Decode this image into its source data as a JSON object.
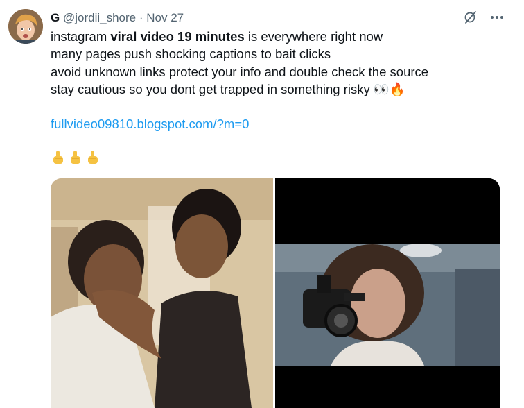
{
  "author": {
    "display_name": "G",
    "handle": "@jordii_shore",
    "separator": "·",
    "date": "Nov 27"
  },
  "tweet": {
    "line1_pre": "instagram ",
    "line1_bold": "viral video 19 minutes",
    "line1_post": " is everywhere right now",
    "line2": "many pages push shocking captions to bait clicks",
    "line3": "avoid unknown links protect your info and double check the source",
    "line4_text": "stay cautious so you dont get trapped in something risky ",
    "line4_emoji_eyes": "👀",
    "line4_emoji_fire": "🔥",
    "link": "fullvideo09810.blogspot.com/?m=0",
    "hand_emojis": [
      "👆",
      "👆",
      "👆"
    ]
  },
  "icons": {
    "grok": "grok-icon",
    "more": "more-icon"
  },
  "colors": {
    "link": "#1d9bf0",
    "meta": "#536471",
    "text": "#0f1419"
  }
}
